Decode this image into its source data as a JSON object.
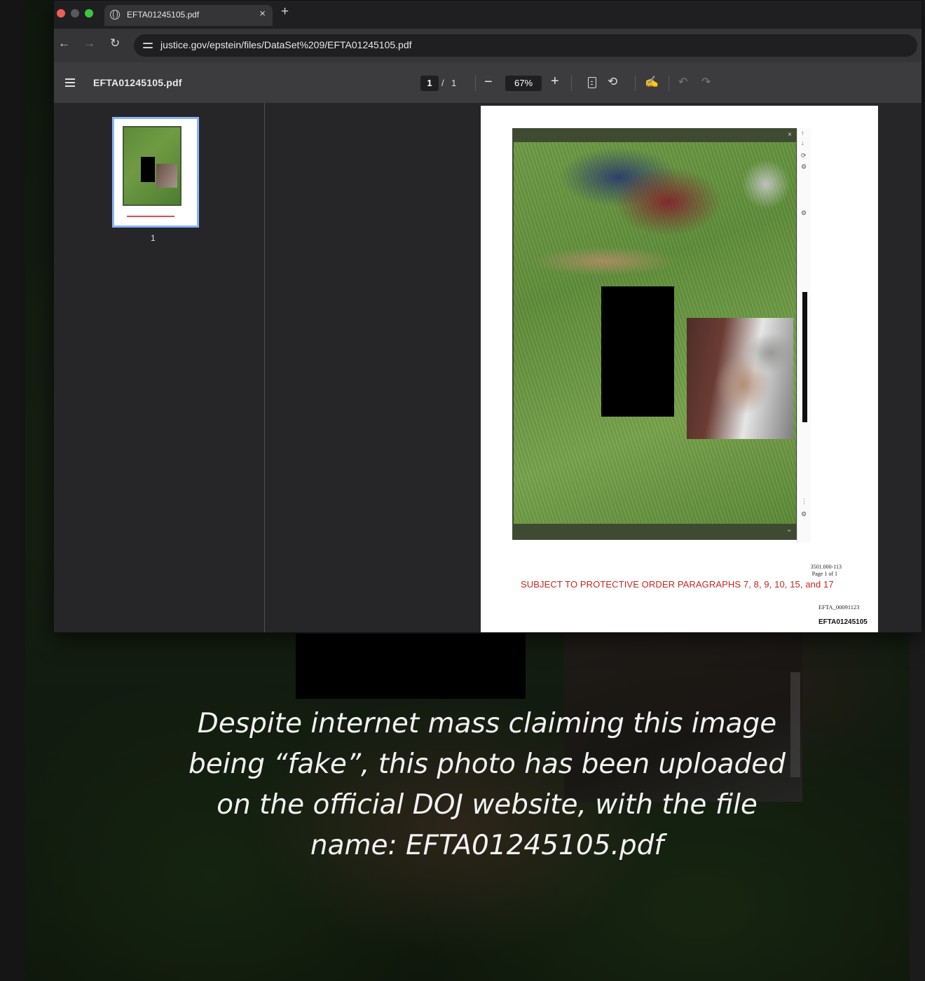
{
  "browser": {
    "tab": {
      "title": "EFTA01245105.pdf",
      "close": "×"
    },
    "new_tab": "+",
    "url": "justice.gov/epstein/files/DataSet%209/EFTA01245105.pdf",
    "nav": {
      "back": "←",
      "forward": "→",
      "reload": "↻"
    }
  },
  "pdf_toolbar": {
    "filename": "EFTA01245105.pdf",
    "page_current": "1",
    "page_separator": "/",
    "page_total": "1",
    "zoom_out": "−",
    "zoom_level": "67%",
    "zoom_in": "+",
    "rotate": "⟲",
    "annotate": "✍",
    "undo": "↶",
    "redo": "↷"
  },
  "sidebar": {
    "thumbnails": [
      {
        "page_number": "1"
      }
    ]
  },
  "document": {
    "frame_close": "×",
    "frame_chevron": "⌄",
    "reference_number": "3501.000-113",
    "page_of": "Page 1 of 1",
    "protective_notice": "SUBJECT TO PROTECTIVE ORDER PARAGRAPHS 7, 8, 9, 10, 15, and 17",
    "efta_small": "EFTA_00091123",
    "efta_bold": "EFTA01245105",
    "strip_buttons": [
      "↑",
      "↓",
      "⟳",
      "⚙",
      "⚙",
      "⋮",
      "⚙"
    ]
  },
  "caption": {
    "line1": "Despite internet mass claiming this image",
    "line2": "being “fake”, this photo has been uploaded",
    "line3": "on the official DOJ website, with the file",
    "line4": "name: EFTA01245105.pdf"
  },
  "colors": {
    "notice_red": "#c8261f",
    "thumb_border": "#8ab4f8",
    "traffic_red": "#ed5f55",
    "traffic_green": "#3ec53f"
  }
}
